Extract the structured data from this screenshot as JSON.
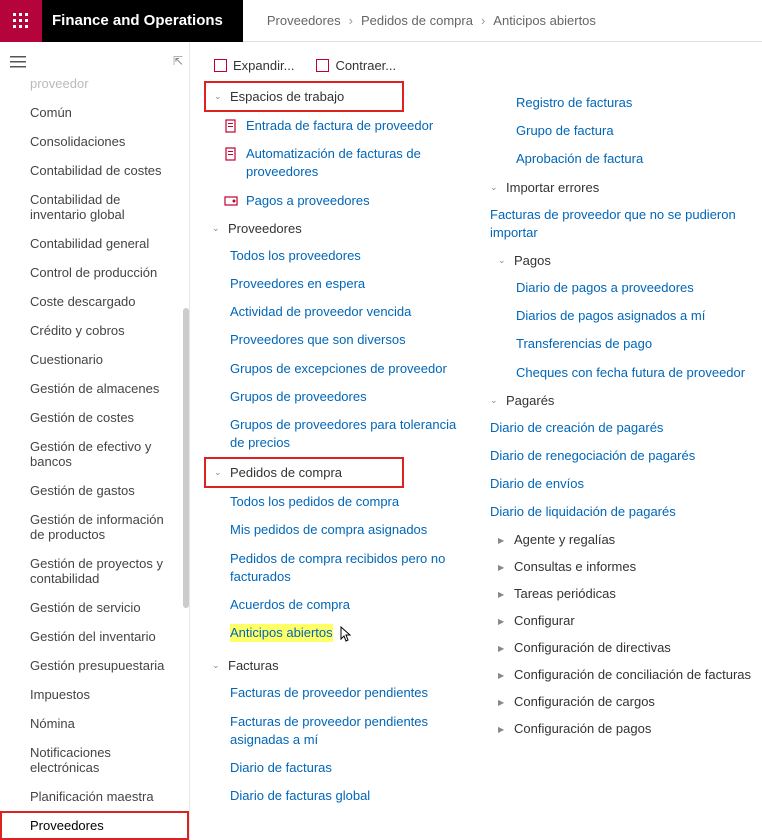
{
  "header": {
    "app_title": "Finance and Operations",
    "breadcrumb": [
      "Proveedores",
      "Pedidos de compra",
      "Anticipos abiertos"
    ]
  },
  "sidebar": {
    "items": [
      "proveedor",
      "Común",
      "Consolidaciones",
      "Contabilidad de costes",
      "Contabilidad de inventario global",
      "Contabilidad general",
      "Control de producción",
      "Coste descargado",
      "Crédito y cobros",
      "Cuestionario",
      "Gestión de almacenes",
      "Gestión de costes",
      "Gestión de efectivo y bancos",
      "Gestión de gastos",
      "Gestión de información de productos",
      "Gestión de proyectos y contabilidad",
      "Gestión de servicio",
      "Gestión del inventario",
      "Gestión presupuestaria",
      "Impuestos",
      "Nómina",
      "Notificaciones electrónicas",
      "Planificación maestra",
      "Proveedores"
    ],
    "selected_index": 23
  },
  "toolbar": {
    "expand": "Expandir...",
    "collapse": "Contraer..."
  },
  "nav": {
    "col1": [
      {
        "type": "group",
        "label": "Espacios de trabajo",
        "boxed": true
      },
      {
        "type": "link",
        "label": "Entrada de factura de proveedor",
        "icon": "doc"
      },
      {
        "type": "link",
        "label": "Automatización de facturas de proveedores",
        "icon": "doc"
      },
      {
        "type": "link",
        "label": "Pagos a proveedores",
        "icon": "pay"
      },
      {
        "type": "group",
        "label": "Proveedores"
      },
      {
        "type": "link",
        "label": "Todos los proveedores"
      },
      {
        "type": "link",
        "label": "Proveedores en espera"
      },
      {
        "type": "link",
        "label": "Actividad de proveedor vencida"
      },
      {
        "type": "link",
        "label": "Proveedores que son diversos"
      },
      {
        "type": "link",
        "label": "Grupos de excepciones de proveedor"
      },
      {
        "type": "link",
        "label": "Grupos de proveedores"
      },
      {
        "type": "link",
        "label": "Grupos de proveedores para tolerancia de precios"
      },
      {
        "type": "group",
        "label": "Pedidos de compra",
        "boxed": true
      },
      {
        "type": "link",
        "label": "Todos los pedidos de compra"
      },
      {
        "type": "link",
        "label": "Mis pedidos de compra asignados"
      },
      {
        "type": "link",
        "label": "Pedidos de compra recibidos pero no facturados"
      },
      {
        "type": "link",
        "label": "Acuerdos de compra"
      },
      {
        "type": "link",
        "label": "Anticipos abiertos",
        "highlighted": true,
        "cursor": true
      },
      {
        "type": "group",
        "label": "Facturas"
      },
      {
        "type": "link",
        "label": "Facturas de proveedor pendientes"
      },
      {
        "type": "link",
        "label": "Facturas de proveedor pendientes asignadas a mí"
      },
      {
        "type": "link",
        "label": "Diario de facturas"
      },
      {
        "type": "link",
        "label": "Diario de facturas global"
      }
    ],
    "col2": [
      {
        "type": "link",
        "label": "Registro de facturas"
      },
      {
        "type": "link",
        "label": "Grupo de factura"
      },
      {
        "type": "link",
        "label": "Aprobación de factura"
      },
      {
        "type": "group",
        "label": "Importar errores",
        "nested": true
      },
      {
        "type": "link",
        "label": "Facturas de proveedor que no se pudieron importar",
        "nested": true
      },
      {
        "type": "group",
        "label": "Pagos"
      },
      {
        "type": "link",
        "label": "Diario de pagos a proveedores"
      },
      {
        "type": "link",
        "label": "Diarios de pagos asignados a mí"
      },
      {
        "type": "link",
        "label": "Transferencias de pago"
      },
      {
        "type": "link",
        "label": "Cheques con fecha futura de proveedor"
      },
      {
        "type": "group",
        "label": "Pagarés",
        "nested": true
      },
      {
        "type": "link",
        "label": "Diario de creación de pagarés",
        "nested": true
      },
      {
        "type": "link",
        "label": "Diario de renegociación de pagarés",
        "nested": true
      },
      {
        "type": "link",
        "label": "Diario de envíos",
        "nested": true
      },
      {
        "type": "link",
        "label": "Diario de liquidación de pagarés",
        "nested": true
      },
      {
        "type": "group",
        "label": "Agente y regalías",
        "collapsed": true
      },
      {
        "type": "group",
        "label": "Consultas e informes",
        "collapsed": true
      },
      {
        "type": "group",
        "label": "Tareas periódicas",
        "collapsed": true
      },
      {
        "type": "group",
        "label": "Configurar",
        "collapsed": true
      },
      {
        "type": "group",
        "label": "Configuración de directivas",
        "collapsed": true
      },
      {
        "type": "group",
        "label": "Configuración de conciliación de facturas",
        "collapsed": true
      },
      {
        "type": "group",
        "label": "Configuración de cargos",
        "collapsed": true
      },
      {
        "type": "group",
        "label": "Configuración de pagos",
        "collapsed": true
      }
    ]
  }
}
